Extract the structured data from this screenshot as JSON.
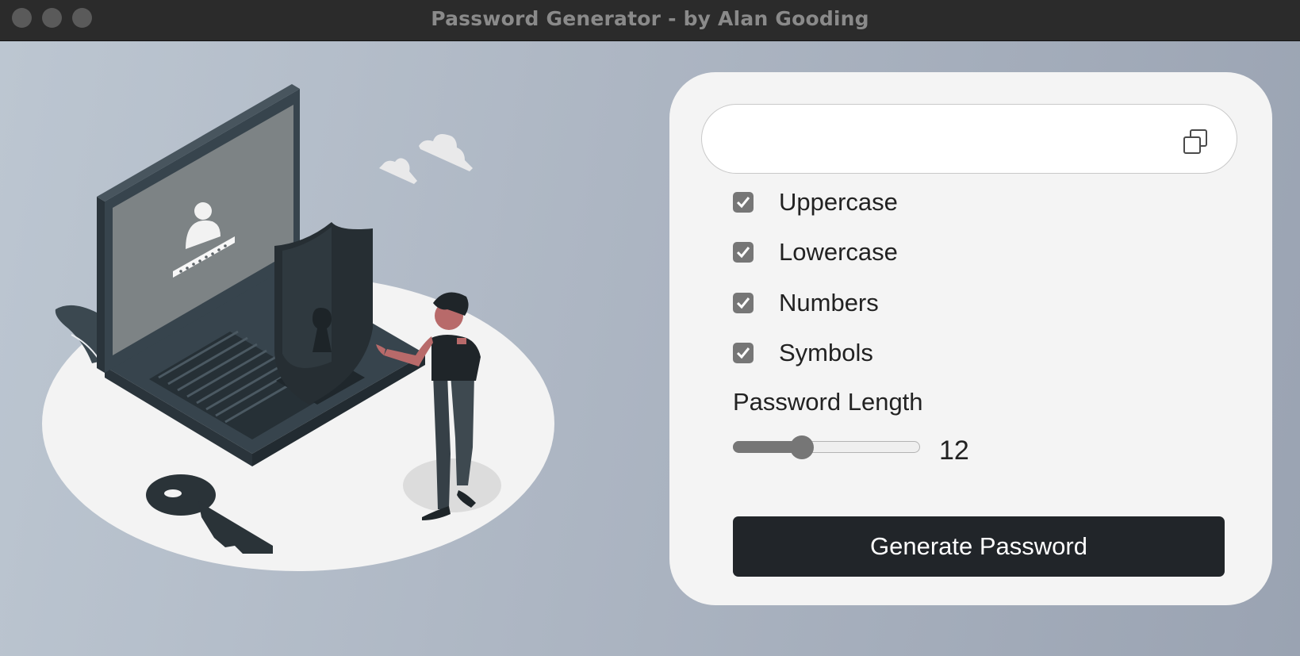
{
  "window": {
    "title": "Password Generator - by Alan Gooding",
    "controls": [
      "close-icon",
      "minimize-icon",
      "zoom-icon"
    ]
  },
  "illustration": {
    "subject": "laptop-security-illustration",
    "icons": [
      "laptop-icon",
      "shield-keyhole-icon",
      "key-icon",
      "user-avatar-icon",
      "cloud-icon",
      "person-figure"
    ]
  },
  "generator": {
    "password_value": "",
    "copy_icon": "copy-icon",
    "options": [
      {
        "label": "Uppercase",
        "checked": true
      },
      {
        "label": "Lowercase",
        "checked": true
      },
      {
        "label": "Numbers",
        "checked": true
      },
      {
        "label": "Symbols",
        "checked": true
      }
    ],
    "length_label": "Password Length",
    "length_value": "12",
    "length_fraction": 0.35,
    "generate_label": "Generate Password"
  },
  "colors": {
    "titlebar": "#2b2b2b",
    "card": "#f4f4f4",
    "button": "#212529",
    "checkbox": "#767676"
  }
}
